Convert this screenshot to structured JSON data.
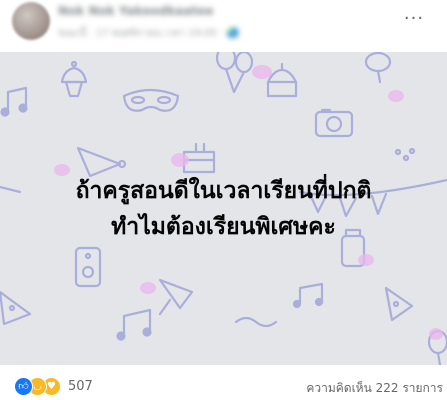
{
  "post": {
    "author": "Nok Nok Yakoodkaatee",
    "meta": "ขณะนี้ · 17 พฤศจิกายน เวลา 19:05 · 🌏",
    "more_label": "···",
    "text_lines": [
      "ถ้าครูสอนดีในเวลาเรียนที่ปกติ",
      "ทำไมต้องเรียนพิเศษคะ"
    ],
    "background_color": "#e4e5e9"
  },
  "footer": {
    "reaction_count": "507",
    "comments_label": "ความคิดเห็น 222 รายการ",
    "reactions": [
      {
        "name": "like-reaction-icon",
        "color": "#1877f2"
      },
      {
        "name": "haha-reaction-icon",
        "color": "#f7b928"
      },
      {
        "name": "love-face-reaction-icon",
        "color": "#f7b928"
      }
    ]
  }
}
